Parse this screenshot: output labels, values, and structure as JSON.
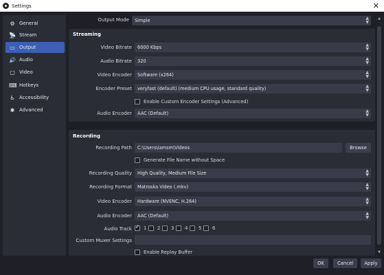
{
  "window": {
    "title": "Settings",
    "close_label": "✕"
  },
  "sidebar": {
    "items": [
      {
        "label": "General",
        "icon": "gear-icon"
      },
      {
        "label": "Stream",
        "icon": "stream-icon"
      },
      {
        "label": "Output",
        "icon": "output-icon",
        "active": true
      },
      {
        "label": "Audio",
        "icon": "audio-icon"
      },
      {
        "label": "Video",
        "icon": "video-icon"
      },
      {
        "label": "Hotkeys",
        "icon": "keyboard-icon"
      },
      {
        "label": "Accessibility",
        "icon": "accessibility-icon"
      },
      {
        "label": "Advanced",
        "icon": "advanced-icon"
      }
    ]
  },
  "output_mode": {
    "label": "Output Mode",
    "value": "Simple"
  },
  "streaming": {
    "title": "Streaming",
    "video_bitrate": {
      "label": "Video Bitrate",
      "value": "6000 Kbps"
    },
    "audio_bitrate": {
      "label": "Audio Bitrate",
      "value": "320"
    },
    "video_encoder": {
      "label": "Video Encoder",
      "value": "Software (x264)"
    },
    "encoder_preset": {
      "label": "Encoder Preset",
      "value": "veryfast (default) (medium CPU usage, standard quality)"
    },
    "custom_encoder": {
      "label": "Enable Custom Encoder Settings (Advanced)",
      "checked": false
    },
    "audio_encoder": {
      "label": "Audio Encoder",
      "value": "AAC (Default)"
    }
  },
  "recording": {
    "title": "Recording",
    "path": {
      "label": "Recording Path",
      "value": "C:\\Users\\iamsm\\Videos",
      "browse_label": "Browse"
    },
    "no_space": {
      "label": "Generate File Name without Space",
      "checked": false
    },
    "quality": {
      "label": "Recording Quality",
      "value": "High Quality, Medium File Size"
    },
    "format": {
      "label": "Recording Format",
      "value": "Matroska Video (.mkv)"
    },
    "video_encoder": {
      "label": "Video Encoder",
      "value": "Hardware (NVENC, H.264)"
    },
    "audio_encoder": {
      "label": "Audio Encoder",
      "value": "AAC (Default)"
    },
    "audio_track": {
      "label": "Audio Track",
      "tracks": [
        {
          "label": "1",
          "checked": true
        },
        {
          "label": "2",
          "checked": false
        },
        {
          "label": "3",
          "checked": false
        },
        {
          "label": "4",
          "checked": false
        },
        {
          "label": "5",
          "checked": false
        },
        {
          "label": "6",
          "checked": false
        }
      ]
    },
    "muxer": {
      "label": "Custom Muxer Settings",
      "value": ""
    },
    "replay_buffer": {
      "label": "Enable Replay Buffer",
      "checked": false
    }
  },
  "footer": {
    "ok_label": "OK",
    "cancel_label": "Cancel",
    "apply_label": "Apply"
  },
  "colors": {
    "accent": "#3c5fb5",
    "background": "#1f2027",
    "panel": "#2a2c36",
    "field": "#393b48"
  }
}
